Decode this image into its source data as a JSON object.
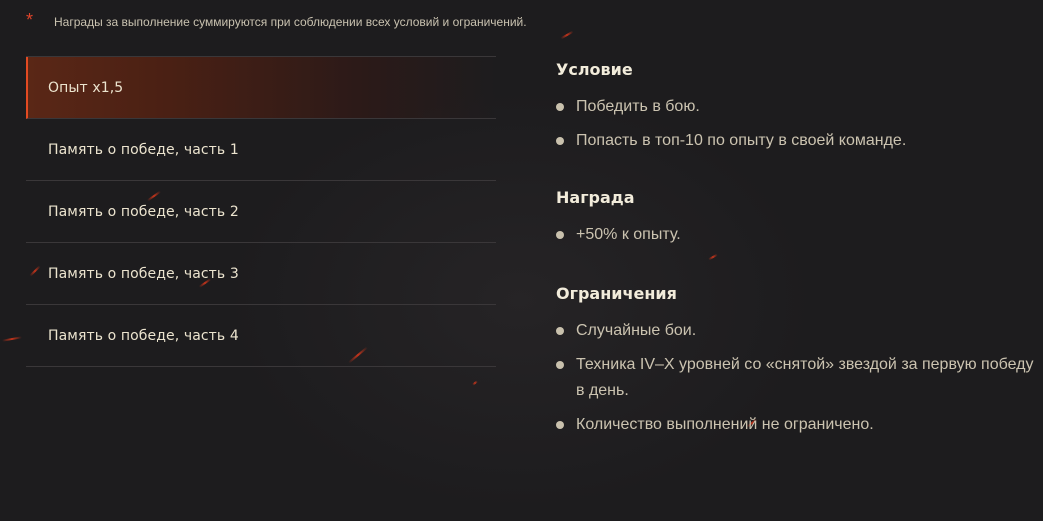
{
  "footnote": {
    "marker": "*",
    "text": "Награды за выполнение суммируются при соблюдении всех условий и ограничений."
  },
  "tasks": [
    {
      "label": "Опыт x1,5",
      "active": true
    },
    {
      "label": "Память о победе, часть 1",
      "active": false
    },
    {
      "label": "Память о победе, часть 2",
      "active": false
    },
    {
      "label": "Память о победе, часть 3",
      "active": false
    },
    {
      "label": "Память о победе, часть 4",
      "active": false
    }
  ],
  "details": {
    "condition": {
      "title": "Условие",
      "items": [
        "Победить в бою.",
        "Попасть в топ-10 по опыту в своей команде."
      ]
    },
    "reward": {
      "title": "Награда",
      "items": [
        "+50% к опыту."
      ]
    },
    "restrictions": {
      "title": "Ограничения",
      "items": [
        "Случайные бои.",
        "Техника IV–X уровней со «снятой» звездой за первую победу в день.",
        "Количество выполнений не ограничено."
      ]
    }
  },
  "colors": {
    "background": "#1d1c1e",
    "accent": "#e24a22",
    "active_gradient": "#5a2716",
    "text_primary": "#ece4cf",
    "text_secondary": "#cbc3b0"
  }
}
